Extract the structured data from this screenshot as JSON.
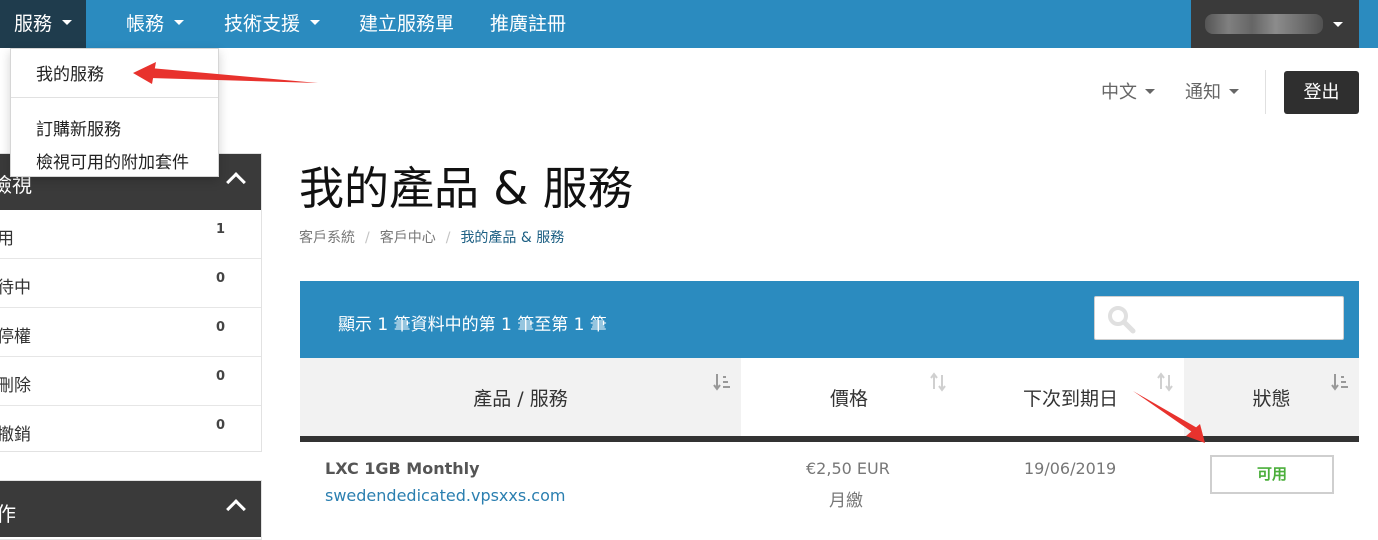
{
  "nav": {
    "items": [
      "服務",
      "帳務",
      "技術支援",
      "建立服務單",
      "推廣註冊"
    ]
  },
  "dropdown": {
    "items": [
      "我的服務",
      "訂購新服務",
      "檢視可用的附加套件"
    ]
  },
  "sidebar": {
    "panel1_title": "檢視",
    "rows": [
      {
        "label": "用",
        "count": "1"
      },
      {
        "label": "待中",
        "count": "0"
      },
      {
        "label": "停權",
        "count": "0"
      },
      {
        "label": "刪除",
        "count": "0"
      },
      {
        "label": "撤銷",
        "count": "0"
      }
    ],
    "panel2_title": "作"
  },
  "header": {
    "language": "中文",
    "notifications": "通知",
    "logout": "登出"
  },
  "page": {
    "title": "我的產品 & 服務",
    "breadcrumb": [
      "客戶系統",
      "客戶中心",
      "我的產品 & 服務"
    ]
  },
  "table": {
    "info": "顯示 1 筆資料中的第 1 筆至第 1 筆",
    "search_placeholder": "",
    "columns": [
      "產品 / 服務",
      "價格",
      "下次到期日",
      "狀態"
    ],
    "rows": [
      {
        "product": "LXC 1GB Monthly",
        "domain": "swedendedicated.vpsxxs.com",
        "price": "€2,50 EUR",
        "cycle": "月繳",
        "due_date": "19/06/2019",
        "status": "可用"
      }
    ]
  },
  "colors": {
    "nav_bg": "#2b8bbf",
    "nav_active": "#1f3c4d",
    "status_green": "#4caf3c",
    "annotation_red": "#e8322d"
  }
}
